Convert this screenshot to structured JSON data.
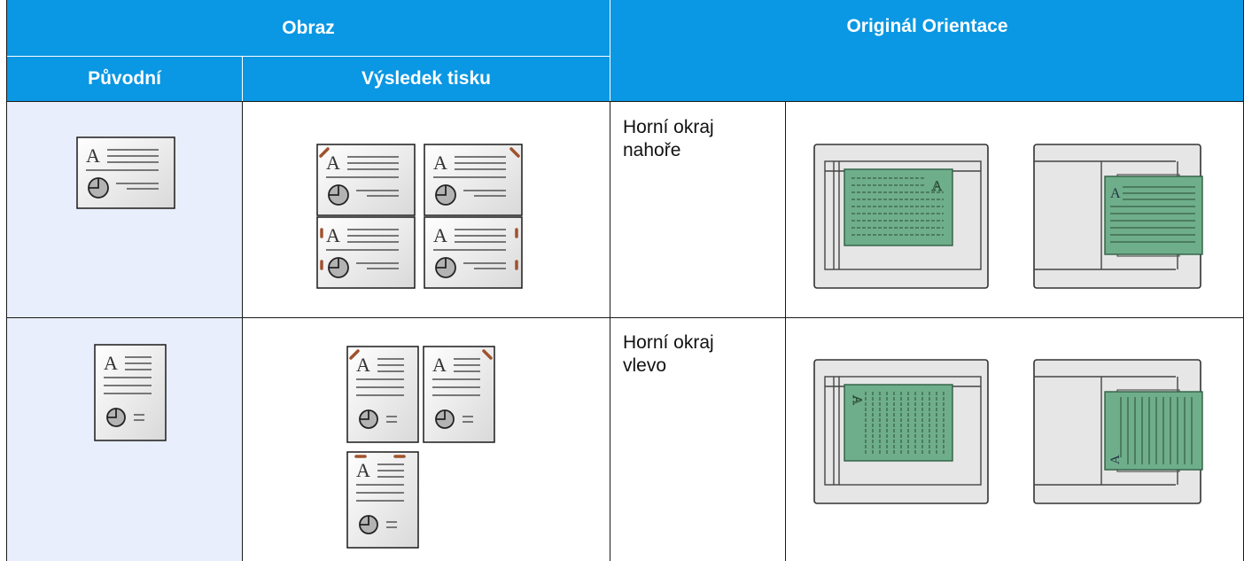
{
  "header": {
    "image": "Obraz",
    "original_orientation": "Originál Orientace",
    "original": "Původní",
    "print_result": "Výsledek tisku"
  },
  "rows": [
    {
      "orientation_label": "Horní okraj nahoře",
      "line1": "Horní okraj",
      "line2": "nahoře"
    },
    {
      "orientation_label": "Horní okraj vlevo",
      "line1": "Horní okraj",
      "line2": "vlevo"
    }
  ],
  "icons": {
    "doc_letter": "A",
    "landscape_doc": "landscape-document-icon",
    "portrait_doc": "portrait-document-icon",
    "platen": "glass-platen-icon",
    "feeder": "document-feeder-icon"
  },
  "colors": {
    "header_bg": "#0a97e3",
    "original_cell_bg": "#e8eefb",
    "staple": "#a0522d",
    "paper_green": "#6fae8a",
    "scanner_gray": "#e6e6e6"
  }
}
